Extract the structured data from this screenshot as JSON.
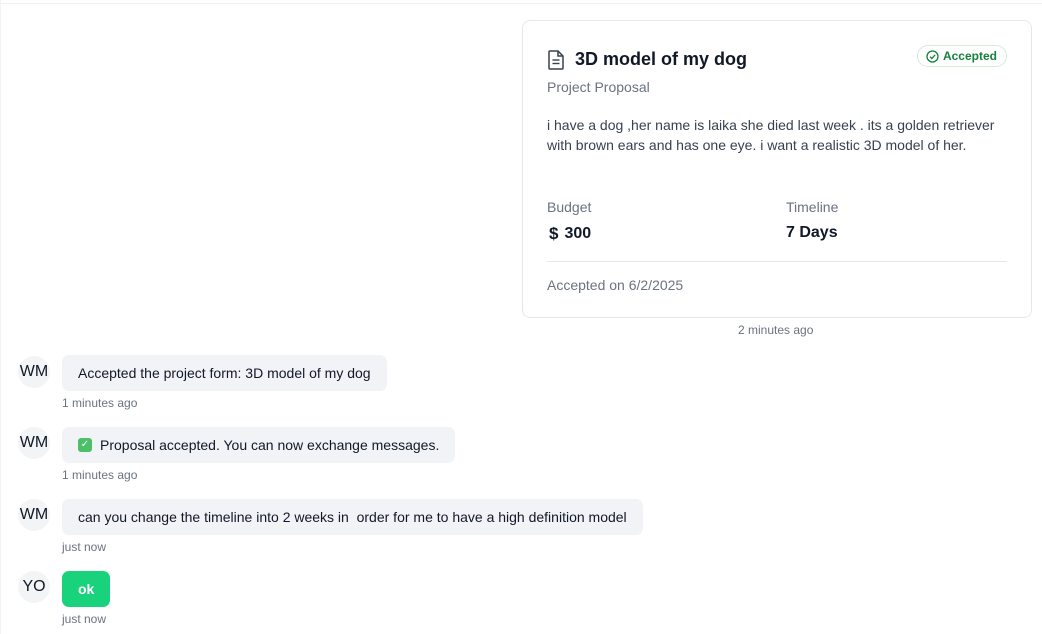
{
  "proposal": {
    "title": "3D model of my dog",
    "status": "Accepted",
    "subtitle": "Project Proposal",
    "description": "i have a dog ,her name is laika she died last week . its a golden retriever with brown ears and has one eye. i want a realistic 3D model of her.",
    "budget_label": "Budget",
    "budget_currency": "$",
    "budget_value": "300",
    "timeline_label": "Timeline",
    "timeline_value": "7 Days",
    "accepted_on": "Accepted on 6/2/2025",
    "time": "2 minutes ago",
    "icons": {
      "title": "document-icon",
      "status": "check-circle-icon"
    },
    "colors": {
      "status": "#16803c",
      "own_bubble": "#19d27c"
    }
  },
  "messages": [
    {
      "sender": "WM",
      "text": "Accepted the project form: 3D model of my dog",
      "time": "1 minutes ago"
    },
    {
      "sender": "WM",
      "text": "Proposal accepted. You can now exchange messages.",
      "time": "1 minutes ago",
      "icon": "check-box-icon"
    },
    {
      "sender": "WM",
      "text": "can you change the timeline into 2 weeks in  order for me to have a high definition model",
      "time": "just now"
    },
    {
      "sender": "YO",
      "text": "ok",
      "time": "just now"
    }
  ]
}
